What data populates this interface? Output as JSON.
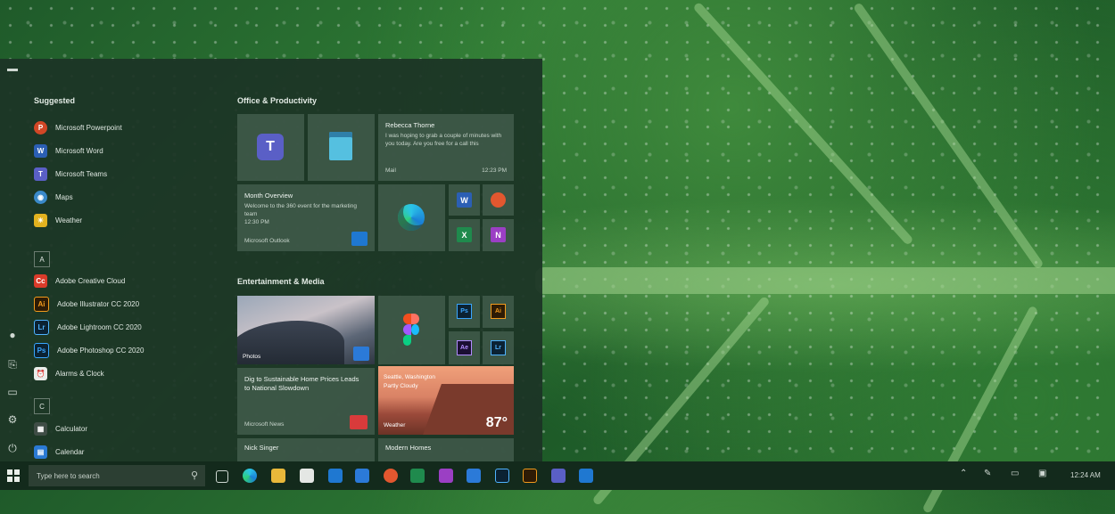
{
  "start_menu": {
    "suggested": {
      "title": "Suggested",
      "items": [
        {
          "label": "Microsoft Powerpoint",
          "color": "#d24726",
          "glyph": "P"
        },
        {
          "label": "Microsoft Word",
          "color": "#2b5fb4",
          "glyph": "W"
        },
        {
          "label": "Microsoft Teams",
          "color": "#5a5fc6",
          "glyph": "T"
        },
        {
          "label": "Maps",
          "color": "#3a89c9",
          "glyph": "◉"
        },
        {
          "label": "Weather",
          "color": "#e3b21f",
          "glyph": "☀"
        }
      ]
    },
    "sections": [
      {
        "letter": "A",
        "items": [
          {
            "label": "Adobe Creative Cloud",
            "color": "#da3b2a",
            "glyph": "Cc"
          },
          {
            "label": "Adobe Illustrator CC 2020",
            "color": "#2e1b05",
            "glyph": "Ai",
            "fg": "#f29b1d"
          },
          {
            "label": "Adobe Lightroom CC 2020",
            "color": "#0b2233",
            "glyph": "Lr",
            "fg": "#4fb3ff"
          },
          {
            "label": "Adobe Photoshop CC 2020",
            "color": "#0b2233",
            "glyph": "Ps",
            "fg": "#39a6ff"
          },
          {
            "label": "Alarms & Clock",
            "color": "#e9ece9",
            "glyph": "⏰",
            "fg": "#1c3426"
          }
        ]
      },
      {
        "letter": "C",
        "items": [
          {
            "label": "Calculator",
            "color": "#3f4d46",
            "glyph": "▦"
          },
          {
            "label": "Calendar",
            "color": "#2a7ad4",
            "glyph": "▤"
          }
        ]
      }
    ],
    "groups": {
      "office": "Office & Productivity",
      "entertainment": "Entertainment & Media"
    },
    "tiles": {
      "mail": {
        "sender": "Rebecca Thorne",
        "body": "I was hoping to grab a couple of minutes with you today. Are you free for a call this afternoon?",
        "app": "Mail",
        "time": "12:23 PM"
      },
      "calendar": {
        "title": "Month Overview",
        "body": "Welcome to the 360 event for the marketing team",
        "time": "12:30 PM",
        "app": "Microsoft Outlook"
      },
      "news": {
        "headline": "Dig to Sustainable Home Prices Leads to National Slowdown",
        "source": "Microsoft News"
      },
      "weather": {
        "city": "Seattle, Washington",
        "desc": "Partly Cloudy",
        "app": "Weather",
        "temp": "87°"
      },
      "photos": {
        "label": "Photos"
      },
      "music": {
        "artist": "Nick Singer"
      },
      "mobile": {
        "title": "Modern Homes"
      }
    }
  },
  "taskbar": {
    "search_placeholder": "Type here to search",
    "clock": "12:24 AM"
  }
}
